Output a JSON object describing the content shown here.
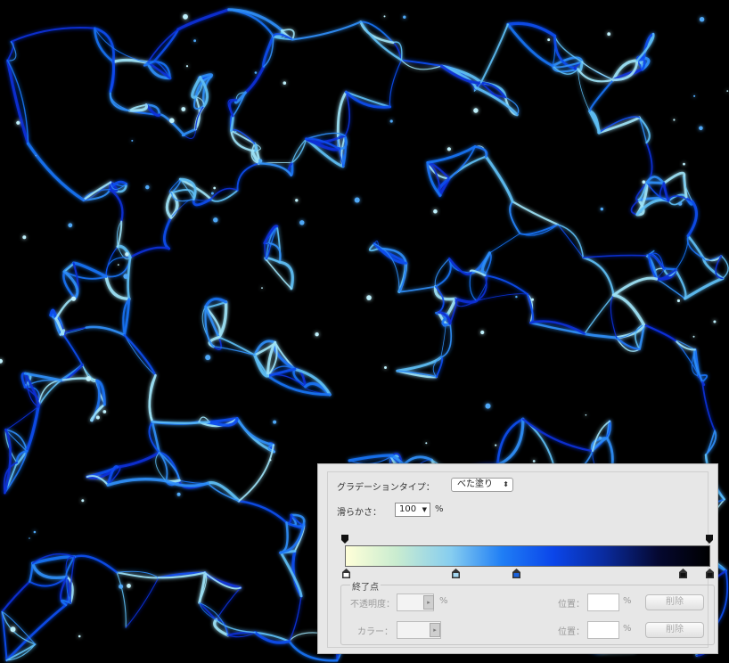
{
  "gradient_editor": {
    "gradient_type_label": "グラデーションタイプ：",
    "gradient_type_value": "べた塗り",
    "smoothness_label": "滑らかさ：",
    "smoothness_value": "100",
    "smoothness_unit": "%",
    "stops_group_label": "終了点",
    "opacity_label": "不透明度：",
    "opacity_unit": "%",
    "color_label": "カラー：",
    "location_label_1": "位置：",
    "location_unit_1": "%",
    "delete_label_1": "削除",
    "location_label_2": "位置：",
    "location_unit_2": "%",
    "delete_label_2": "削除",
    "gradient_colors": [
      "#ffffd8",
      "#c9ecd0",
      "#86cdf0",
      "#1f7ef5",
      "#0b46ea",
      "#0a2b9e",
      "#050830",
      "#000000"
    ],
    "color_stop_colors": [
      "#ffffff",
      "#a6d8f2",
      "#1a63e0",
      "#111111",
      "#111111"
    ]
  }
}
